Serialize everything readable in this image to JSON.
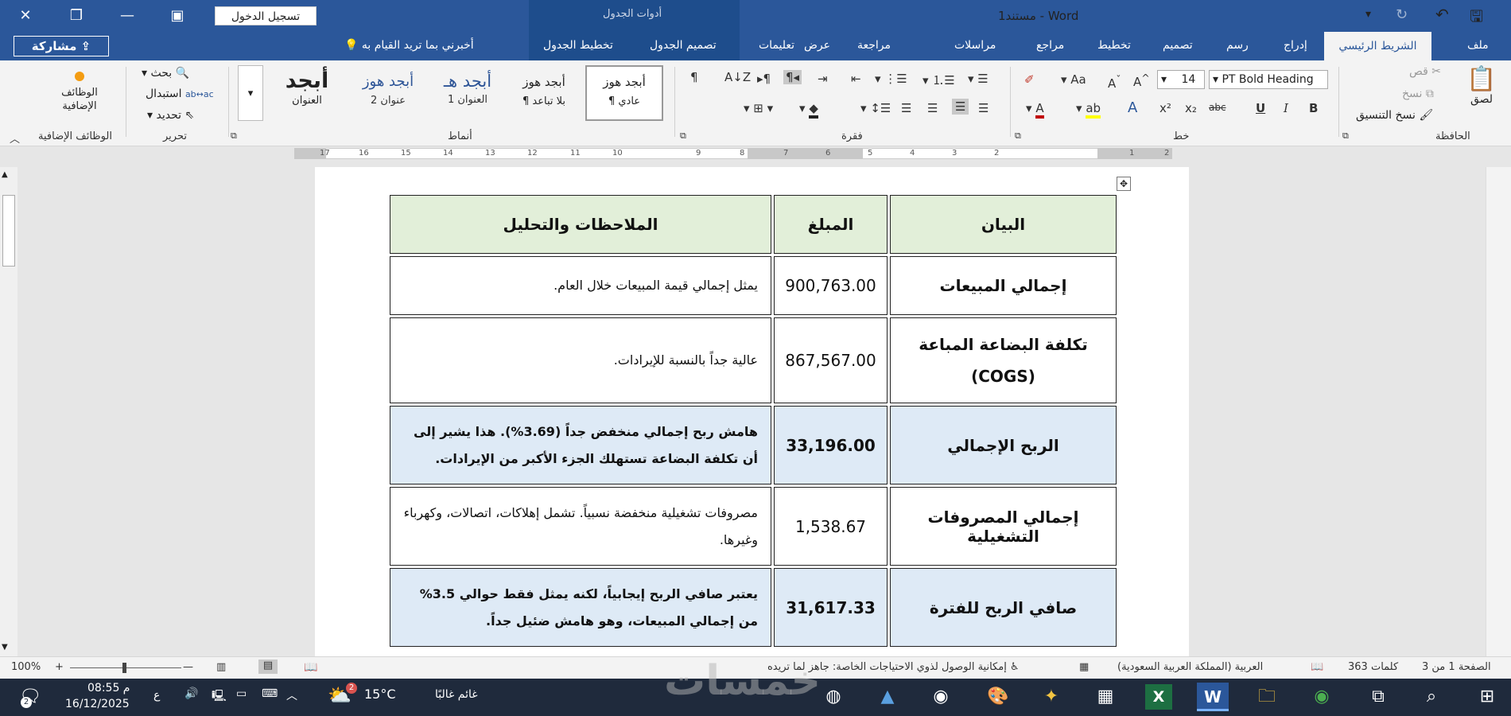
{
  "titlebar": {
    "doc_title": "Word  -  مستند1",
    "table_tools": "أدوات الجدول",
    "signin": "تسجيل الدخول",
    "share": "مشاركة"
  },
  "tabs": [
    "ملف",
    "الشريط الرئيسي",
    "إدراج",
    "رسم",
    "تصميم",
    "تخطيط",
    "مراجع",
    "مراسلات",
    "مراجعة",
    "عرض",
    "تعليمات",
    "تصميم الجدول",
    "تخطيط الجدول",
    "أخبرني بما تريد القيام به"
  ],
  "ribbon": {
    "clipboard": {
      "paste": "لصق",
      "cut": "قص",
      "copy": "نسخ",
      "format_painter": "نسخ التنسيق",
      "group": "الحافظة"
    },
    "font": {
      "name": "PT Bold Heading",
      "size": "14",
      "group": "خط"
    },
    "paragraph": {
      "group": "فقرة"
    },
    "styles": {
      "group": "أنماط",
      "items": [
        {
          "preview": "أبجد هوز",
          "label": "¶ عادي"
        },
        {
          "preview": "أبجد هوز",
          "label": "¶ بلا تباعد"
        },
        {
          "preview": "أبجد هـ",
          "label": "العنوان 1"
        },
        {
          "preview": "أبجد هوز",
          "label": "عنوان 2"
        },
        {
          "preview": "أبجد",
          "label": "العنوان"
        }
      ]
    },
    "editing": {
      "find": "بحث",
      "replace": "استبدال",
      "select": "تحديد",
      "group": "تحرير"
    },
    "addins": {
      "label": "الوظائف الإضافية",
      "group": "الوظائف الإضافية"
    }
  },
  "ruler": {
    "ticks": [
      "2",
      "1",
      "2",
      "3",
      "4",
      "5",
      "6",
      "7",
      "8",
      "9",
      "10",
      "11",
      "12",
      "13",
      "14",
      "15",
      "16",
      "17",
      "18"
    ]
  },
  "table": {
    "headers": [
      "البيان",
      "المبلغ",
      "الملاحظات والتحليل"
    ],
    "rows": [
      {
        "item": "إجمالي المبيعات",
        "amount": "900,763.00",
        "note": "يمثل إجمالي قيمة المبيعات خلال العام."
      },
      {
        "item": "تكلفة البضاعة المباعة (COGS)",
        "amount": "867,567.00",
        "note": "عالية جداً بالنسبة للإيرادات."
      },
      {
        "item": "الربح الإجمالي",
        "amount": "33,196.00",
        "note": "هامش ربح إجمالي منخفض جداً (3.69%). هذا يشير إلى أن تكلفة البضاعة تستهلك الجزء الأكبر من الإيرادات."
      },
      {
        "item": "إجمالي المصروفات التشغيلية",
        "amount": "1,538.67",
        "note": "مصروفات تشغيلية منخفضة نسبياً. تشمل إهلاكات، اتصالات، وكهرباء وغيرها."
      },
      {
        "item": "صافي الربح للفترة",
        "amount": "31,617.33",
        "note": "يعتبر صافي الربح إيجابياً، لكنه يمثل فقط حوالي 3.5% من إجمالي المبيعات، وهو هامش ضئيل جداً."
      }
    ]
  },
  "status": {
    "page": "الصفحة 1 من 3",
    "words": "363 كلمات",
    "language": "العربية (المملكة العربية السعودية)",
    "accessibility": "إمكانية الوصول لذوي الاحتياجات الخاصة: جاهز لما تريده",
    "zoom": "100%"
  },
  "taskbar": {
    "weather_temp": "15°C",
    "weather_desc": "غائم غالبًا",
    "time": "08:55 م",
    "date": "16/12/2025",
    "lang": "ع",
    "notif_count": "2",
    "weather_badge": "2"
  },
  "watermark": "خمسات",
  "colors": {
    "word_blue": "#2b579a",
    "header_green": "#e2efd9",
    "highlight_blue": "#deeaf6"
  }
}
